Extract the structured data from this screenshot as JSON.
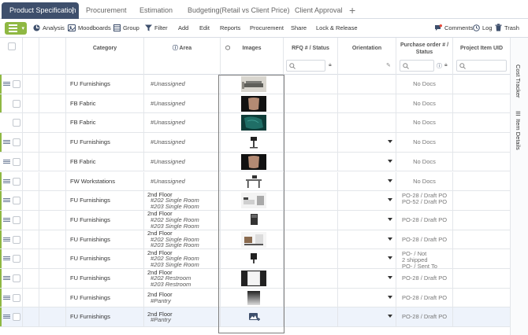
{
  "tabs": [
    {
      "label": "Product Specification",
      "active": true
    },
    {
      "label": "Procurement"
    },
    {
      "label": "Estimation"
    },
    {
      "label": "Budgeting(Retail vs Client Price)"
    },
    {
      "label": "Client Approval"
    }
  ],
  "tab_menu_glyph": "⋮",
  "add_tab_glyph": "+",
  "toolbar": {
    "analysis": "Analysis",
    "moodboards": "Moodboards",
    "group": "Group",
    "filter": "Filter",
    "add": "Add",
    "edit": "Edit",
    "reports": "Reports",
    "procurement": "Procurement",
    "share": "Share",
    "lock_release": "Lock & Release",
    "comments": "Comments",
    "log": "Log",
    "trash": "Trash"
  },
  "columns": {
    "category": "Category",
    "area": "Area",
    "images": "Images",
    "rfq_line1": "RFQ # / Status",
    "orientation": "Orientation",
    "po_line1": "Purchase order # /",
    "po_line2": "Status",
    "uid": "Project Item UID"
  },
  "side_panel": {
    "cost_tracker": "Cost Tracker",
    "item_details": "Item Details"
  },
  "rows": [
    {
      "category": "FU Furnishings",
      "area_unassigned": "#Unassigned",
      "image": "sofa",
      "po_text": "No Docs",
      "handle": true,
      "green": true
    },
    {
      "category": "FB Fabric",
      "area_unassigned": "#Unassigned",
      "image": "fabric-brown",
      "po_text": "No Docs",
      "handle": false,
      "green": true
    },
    {
      "category": "FB Fabric",
      "area_unassigned": "#Unassigned",
      "image": "fabric-teal",
      "po_text": "No Docs",
      "handle": false,
      "green": false
    },
    {
      "category": "FU Furnishings",
      "area_unassigned": "#Unassigned",
      "image": "stool",
      "po_text": "No Docs",
      "handle": true,
      "green": true
    },
    {
      "category": "FB Fabric",
      "area_unassigned": "#Unassigned",
      "image": "fabric-brown",
      "po_text": "No Docs",
      "handle": true,
      "green": false
    },
    {
      "category": "FW Workstations",
      "area_unassigned": "#Unassigned",
      "image": "desk",
      "po_text": "No Docs",
      "handle": true,
      "green": true
    },
    {
      "category": "FU Furnishings",
      "floor": "2nd Floor",
      "rooms": [
        "#202 Single Room",
        "#203 Single Room"
      ],
      "image": "bedroom",
      "po_lines": [
        "PO-28  /  Draft PO",
        "PO-52  /  Draft PO"
      ],
      "handle": true,
      "green": true
    },
    {
      "category": "FU Furnishings",
      "floor": "2nd Floor",
      "rooms": [
        "#202 Single Room",
        "#203 Single Room"
      ],
      "image": "cabinet",
      "po_text": "PO-28  /  Draft PO",
      "handle": true,
      "green": true
    },
    {
      "category": "FU Furnishings",
      "floor": "2nd Floor",
      "rooms": [
        "#202 Single Room",
        "#203 Single Room"
      ],
      "image": "room",
      "po_text": "PO-28  /  Draft PO",
      "handle": true,
      "green": true
    },
    {
      "category": "FU Furnishings",
      "floor": "2nd Floor",
      "rooms": [
        "#202 Single Room",
        "#203 Single Room"
      ],
      "image": "chair",
      "po_lines": [
        "PO-  /    Not",
        "  2       shipped",
        "PO-  /  Sent To"
      ],
      "handle": true,
      "green": true
    },
    {
      "category": "FU Furnishings",
      "floor": "2nd Floor",
      "rooms": [
        "#202 Restroom",
        "#203 Restroom"
      ],
      "image": "mirror",
      "po_text": "PO-28  /  Draft PO",
      "handle": true,
      "green": true
    },
    {
      "category": "FU Furnishings",
      "floor": "2nd Floor",
      "rooms": [
        "#Pantry"
      ],
      "image": "panel",
      "po_text": "PO-28  /  Draft PO",
      "handle": true,
      "green": true
    },
    {
      "category": "FU Furnishings",
      "floor": "2nd Floor",
      "rooms": [
        "#Pantry"
      ],
      "image": "add-image",
      "po_text": "PO-28  /  Draft PO",
      "handle": true,
      "green": true,
      "selected": true
    }
  ],
  "colors": {
    "accent": "#8fb843",
    "active_tab": "#3e4f6c",
    "po_text": "#777777",
    "comment_badge": "#e74c3c"
  }
}
